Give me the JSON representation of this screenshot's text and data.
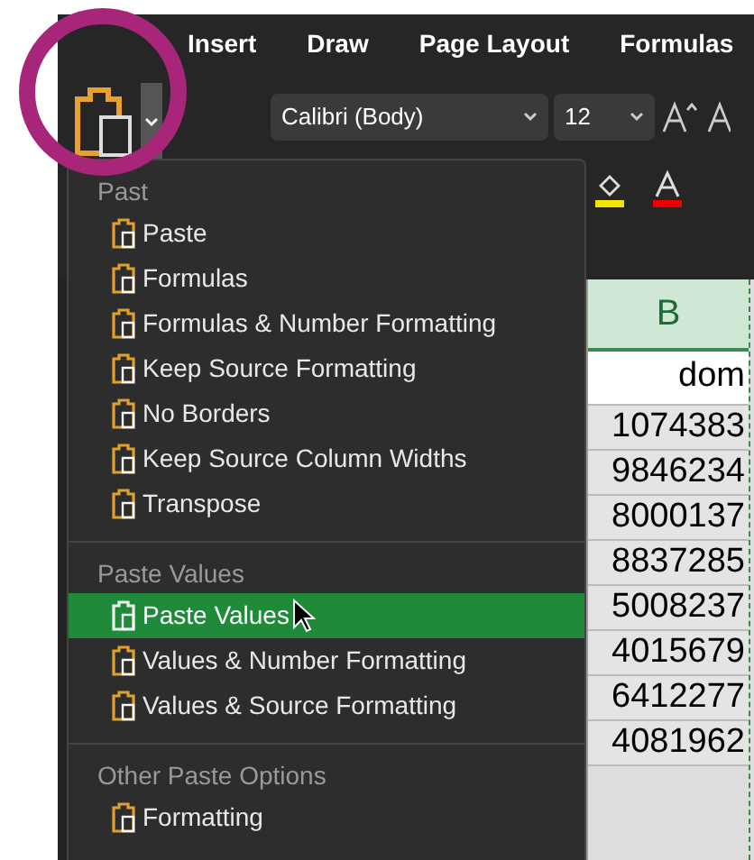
{
  "ribbon": {
    "tabs": [
      {
        "label": "Insert",
        "selected": false
      },
      {
        "label": "Draw",
        "selected": false
      },
      {
        "label": "Page Layout",
        "selected": false
      },
      {
        "label": "Formulas",
        "selected": false
      }
    ],
    "font_name": "Calibri (Body)",
    "font_size": "12"
  },
  "paste_menu": {
    "sections": [
      {
        "header": "Past",
        "items": [
          {
            "label": "Paste",
            "selected": false
          },
          {
            "label": "Formulas",
            "selected": false
          },
          {
            "label": "Formulas & Number Formatting",
            "selected": false
          },
          {
            "label": "Keep Source Formatting",
            "selected": false
          },
          {
            "label": "No Borders",
            "selected": false
          },
          {
            "label": "Keep Source Column Widths",
            "selected": false
          },
          {
            "label": "Transpose",
            "selected": false
          }
        ]
      },
      {
        "header": "Paste Values",
        "items": [
          {
            "label": "Paste Values",
            "selected": true
          },
          {
            "label": "Values & Number Formatting",
            "selected": false
          },
          {
            "label": "Values & Source Formatting",
            "selected": false
          }
        ]
      },
      {
        "header": "Other Paste Options",
        "items": [
          {
            "label": "Formatting",
            "selected": false
          }
        ]
      }
    ]
  },
  "sheet": {
    "column_header": "B",
    "cells": [
      "dom",
      "1074383",
      "9846234",
      "8000137",
      "8837285",
      "5008237",
      "4015679",
      "6412277",
      "4081962"
    ]
  }
}
